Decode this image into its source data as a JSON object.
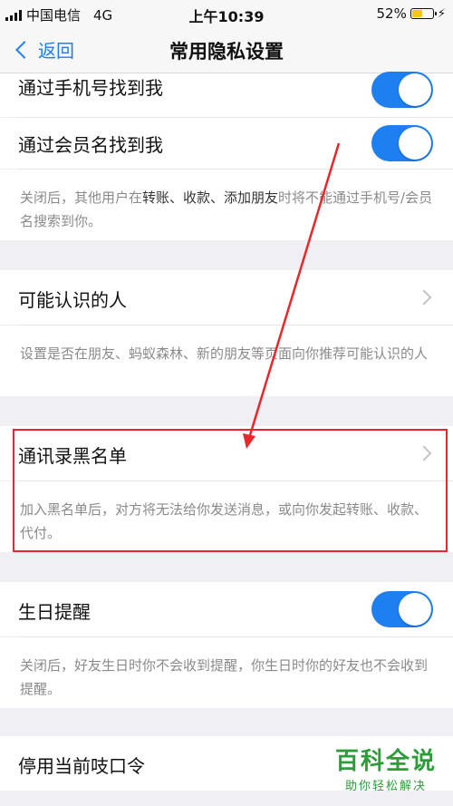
{
  "status_bar": {
    "carrier": "中国电信",
    "network": "4G",
    "time": "上午10:39",
    "battery_percent": "52%",
    "battery_level": 0.52,
    "charging_icon": "⚡"
  },
  "nav": {
    "back_label": "返回",
    "title": "常用隐私设置"
  },
  "rows": {
    "find_by_phone": {
      "label": "通过手机号找到我",
      "toggle_on": true
    },
    "find_by_member": {
      "label": "通过会员名找到我",
      "toggle_on": true
    },
    "find_hint_1": "关闭后，其他用户在",
    "find_hint_bold": "转账、收款、添加朋友",
    "find_hint_2": "时将不能通过手机号/会员名搜索到你。",
    "maybe_know": {
      "label": "可能认识的人"
    },
    "maybe_know_hint": "设置是否在朋友、蚂蚁森林、新的朋友等页面向你推荐可能认识的人",
    "blacklist": {
      "label": "通讯录黑名单"
    },
    "blacklist_hint": "加入黑名单后，对方将无法给你发送消息，或向你发起转账、收款、代付。",
    "birthday": {
      "label": "生日提醒",
      "toggle_on": true
    },
    "birthday_hint": "关闭后，好友生日时你不会收到提醒，你生日时你的好友也不会收到提醒。",
    "password_cmd": {
      "label": "停用当前吱口令"
    }
  },
  "watermark": {
    "main": "百科全说",
    "sub": "助你轻松解决"
  },
  "colors": {
    "accent": "#1e7ff0",
    "highlight": "#e8262b",
    "watermark": "#2e9c3b"
  }
}
